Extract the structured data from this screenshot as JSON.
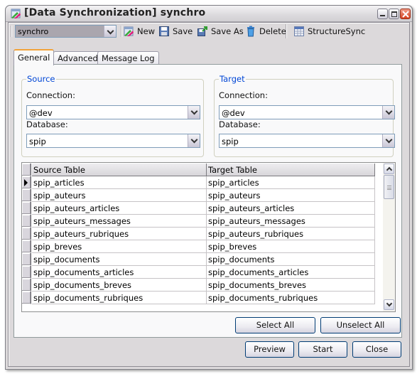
{
  "window": {
    "title": "[Data Synchronization] synchro",
    "icon": "data-sync-icon",
    "controls": {
      "minimize": "minimize-icon",
      "maximize": "maximize-icon",
      "close": "close-icon"
    }
  },
  "toolbar": {
    "profile_value": "synchro",
    "new_label": "New",
    "save_label": "Save",
    "save_as_label": "Save As",
    "delete_label": "Delete",
    "structure_sync_label": "StructureSync"
  },
  "tabs": [
    {
      "label": "General",
      "active": true
    },
    {
      "label": "Advanced",
      "active": false
    },
    {
      "label": "Message Log",
      "active": false
    }
  ],
  "source": {
    "legend": "Source",
    "connection_label": "Connection:",
    "connection_value": "@dev",
    "database_label": "Database:",
    "database_value": "spip"
  },
  "target": {
    "legend": "Target",
    "connection_label": "Connection:",
    "connection_value": "@dev",
    "database_label": "Database:",
    "database_value": "spip"
  },
  "grid": {
    "columns": [
      "Source Table",
      "Target Table"
    ],
    "current_row": 0,
    "rows": [
      [
        "spip_articles",
        "spip_articles"
      ],
      [
        "spip_auteurs",
        "spip_auteurs"
      ],
      [
        "spip_auteurs_articles",
        "spip_auteurs_articles"
      ],
      [
        "spip_auteurs_messages",
        "spip_auteurs_messages"
      ],
      [
        "spip_auteurs_rubriques",
        "spip_auteurs_rubriques"
      ],
      [
        "spip_breves",
        "spip_breves"
      ],
      [
        "spip_documents",
        "spip_documents"
      ],
      [
        "spip_documents_articles",
        "spip_documents_articles"
      ],
      [
        "spip_documents_breves",
        "spip_documents_breves"
      ],
      [
        "spip_documents_rubriques",
        "spip_documents_rubriques"
      ]
    ]
  },
  "buttons": {
    "select_all": "Select All",
    "unselect_all": "Unselect All",
    "preview": "Preview",
    "start": "Start",
    "close": "Close"
  }
}
